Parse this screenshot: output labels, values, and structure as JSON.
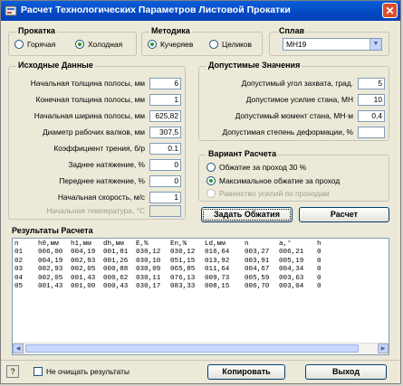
{
  "window": {
    "title": "Расчет Технологических Параметров Листовой Прокатки",
    "close_label": "✕"
  },
  "rolling": {
    "title": "Прокатка",
    "options": [
      "Горячая",
      "Холодная"
    ],
    "selected": "Холодная"
  },
  "method": {
    "title": "Методика",
    "options": [
      "Кучеряев",
      "Целиков"
    ],
    "selected": "Кучеряев"
  },
  "alloy": {
    "title": "Сплав",
    "value": "МН19"
  },
  "input": {
    "title": "Исходные Данные",
    "fields": [
      {
        "label": "Начальная толщина полосы, мм",
        "value": "6",
        "enabled": true
      },
      {
        "label": "Конечная толщина полосы, мм",
        "value": "1",
        "enabled": true
      },
      {
        "label": "Начальная ширина полосы, мм",
        "value": "625,82",
        "enabled": true
      },
      {
        "label": "Диаметр рабочих валков, мм",
        "value": "307,5",
        "enabled": true
      },
      {
        "label": "Коэффициент трения, б/р",
        "value": "0.1",
        "enabled": true
      },
      {
        "label": "Заднее натяжение, %",
        "value": "0",
        "enabled": true
      },
      {
        "label": "Переднее натяжение, %",
        "value": "0",
        "enabled": true
      },
      {
        "label": "Начальная скорость, м/с",
        "value": "1",
        "enabled": true
      },
      {
        "label": "Начальная температура, °С",
        "value": "",
        "enabled": false
      }
    ]
  },
  "limits": {
    "title": "Допустимые Значения",
    "fields": [
      {
        "label": "Допустимый угол захвата, град.",
        "value": "5"
      },
      {
        "label": "Допустимое усилие стана, МН",
        "value": "10"
      },
      {
        "label": "Допустимый момент стана, МН·м",
        "value": "0,4"
      },
      {
        "label": "Допустимая степень деформации, %",
        "value": ""
      }
    ]
  },
  "variant": {
    "title": "Вариант Расчета",
    "options": [
      {
        "label": "Обжатие за проход 30 %",
        "enabled": true
      },
      {
        "label": "Максимальное обжатие за проход",
        "enabled": true
      },
      {
        "label": "Равенство усилий по проходам",
        "enabled": false
      }
    ],
    "selected": "Максимальное обжатие за проход"
  },
  "buttons": {
    "set_reductions": "Задать Обжатия",
    "calculate": "Расчет",
    "copy": "Копировать",
    "exit": "Выход",
    "help": "?"
  },
  "results": {
    "title": "Результаты Расчета",
    "columns": [
      "n",
      "h0,мм",
      "h1,мм",
      "dh,мм",
      "E,%",
      "En,%",
      "Ld,мм",
      "n",
      "a,°",
      "h"
    ],
    "rows": [
      [
        "01",
        "006,00",
        "004,19",
        "001,81",
        "030,12",
        "030,12",
        "016,64",
        "003,27",
        "006,21",
        "0"
      ],
      [
        "02",
        "004,19",
        "002,93",
        "001,26",
        "030,10",
        "051,15",
        "013,92",
        "003,91",
        "005,19",
        "0"
      ],
      [
        "03",
        "002,93",
        "002,05",
        "000,88",
        "030,09",
        "065,85",
        "011,64",
        "004,67",
        "004,34",
        "0"
      ],
      [
        "04",
        "002,05",
        "001,43",
        "000,62",
        "030,11",
        "076,13",
        "009,73",
        "005,59",
        "003,63",
        "0"
      ],
      [
        "05",
        "001,43",
        "001,00",
        "000,43",
        "030,17",
        "083,33",
        "008,15",
        "006,70",
        "003,04",
        "0"
      ]
    ]
  },
  "footer": {
    "keep_results_label": "Не очищать результаты",
    "keep_results_checked": false
  }
}
